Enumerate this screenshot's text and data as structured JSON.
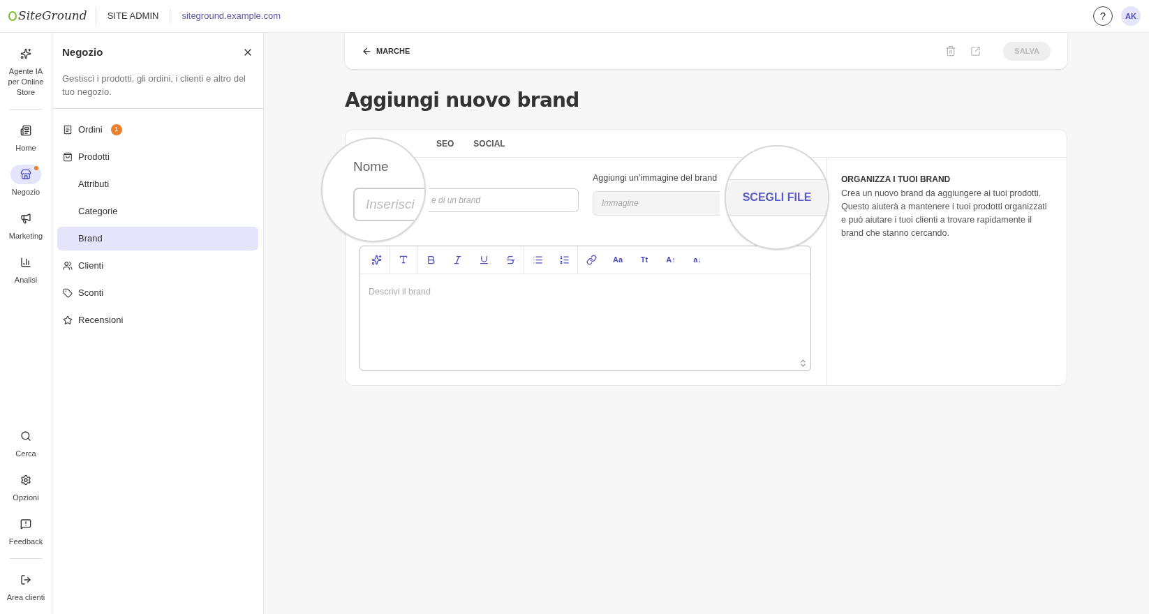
{
  "topbar": {
    "logo": "SiteGround",
    "section": "SITE ADMIN",
    "domain": "siteground.example.com",
    "help": "?",
    "avatar": "AK"
  },
  "rail": {
    "top": [
      {
        "label": "Agente IA per Online Store",
        "selected": false,
        "dot": false
      }
    ],
    "main": [
      {
        "label": "Home",
        "selected": false,
        "dot": false
      },
      {
        "label": "Negozio",
        "selected": true,
        "dot": true
      },
      {
        "label": "Marketing",
        "selected": false,
        "dot": false
      },
      {
        "label": "Analisi",
        "selected": false,
        "dot": false
      }
    ],
    "bottom": [
      {
        "label": "Cerca",
        "selected": false,
        "dot": false
      },
      {
        "label": "Opzioni",
        "selected": false,
        "dot": false
      },
      {
        "label": "Feedback",
        "selected": false,
        "dot": false
      }
    ],
    "footer": [
      {
        "label": "Area clienti",
        "selected": false,
        "dot": false
      }
    ]
  },
  "sidebar": {
    "title": "Negozio",
    "description": "Gestisci i prodotti, gli ordini, i clienti e altro del tuo negozio.",
    "items": [
      {
        "label": "Ordini",
        "badge": "1",
        "selected": false
      },
      {
        "label": "Prodotti",
        "selected": false,
        "children": [
          {
            "label": "Attributi",
            "selected": false
          },
          {
            "label": "Categorie",
            "selected": false
          },
          {
            "label": "Brand",
            "selected": true
          }
        ]
      },
      {
        "label": "Clienti",
        "selected": false
      },
      {
        "label": "Sconti",
        "selected": false
      },
      {
        "label": "Recensioni",
        "selected": false
      }
    ]
  },
  "header": {
    "back": "MARCHE",
    "save": "SALVA",
    "save_disabled": true
  },
  "title": "Aggiungi nuovo brand",
  "tabs": [
    {
      "label": "SEO",
      "selected": false
    },
    {
      "label": "SOCIAL",
      "selected": false
    }
  ],
  "form": {
    "name_placeholder_visible": "e di un brand",
    "image_label": "Aggiungi un'immagine del brand",
    "image_placeholder": "Immagine",
    "editor_placeholder": "Descrivi il brand",
    "toolbar_text": [
      "Aa",
      "Tt",
      "A↑",
      "a↓"
    ]
  },
  "magnifiers": [
    {
      "label": "Nome",
      "placeholder": "Inserisci"
    },
    {
      "button": "SCEGLI FILE"
    }
  ],
  "info": {
    "title": "ORGANIZZA I TUOI BRAND",
    "text": "Crea un nuovo brand da aggiungere ai tuoi prodotti. Questo aiuterà a mantenere i tuoi prodotti organizzati e può aiutare i tuoi clienti a trovare rapidamente il brand che stanno cercando."
  }
}
